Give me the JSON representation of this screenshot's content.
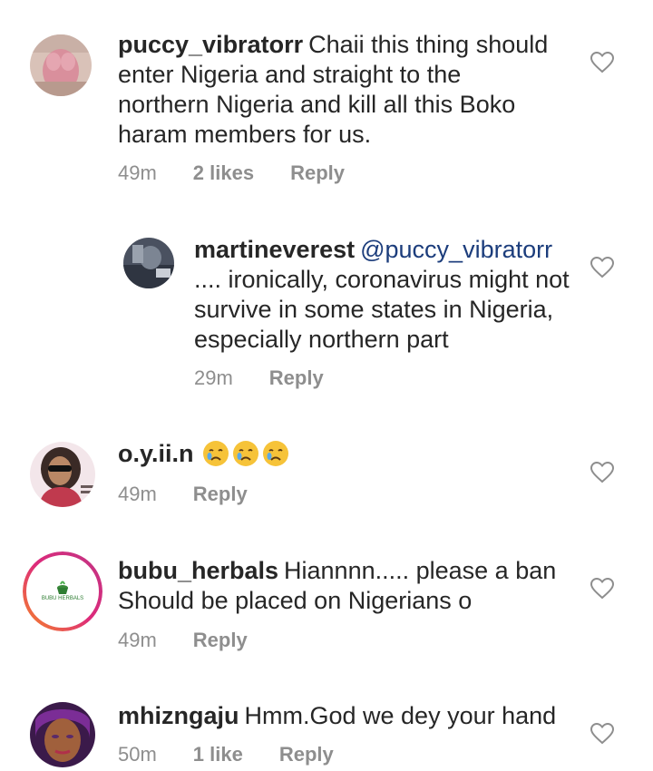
{
  "comments": [
    {
      "username": "puccy_vibratorr",
      "text": "Chaii this thing should enter Nigeria and straight to the northern Nigeria and kill all this Boko haram members for us.",
      "time": "49m",
      "likes": "2 likes",
      "reply": "Reply"
    },
    {
      "username": "martineverest",
      "mention": "@puccy_vibratorr",
      "text": ".... ironically, coronavirus might not survive in some states in Nigeria, especially northern part",
      "time": "29m",
      "reply": "Reply"
    },
    {
      "username": "o.y.ii.n",
      "text": "",
      "emojis": [
        "crying-face-emoji",
        "crying-face-emoji",
        "crying-face-emoji"
      ],
      "time": "49m",
      "reply": "Reply"
    },
    {
      "username": "bubu_herbals",
      "text": "Hiannnn..... please a ban Should be placed on Nigerians o",
      "time": "49m",
      "reply": "Reply",
      "avatar_text": "BUBU HERBALS"
    },
    {
      "username": "mhizngaju",
      "text": "Hmm.God we dey your hand",
      "time": "50m",
      "likes": "1 like",
      "reply": "Reply"
    }
  ],
  "colors": {
    "text": "#262626",
    "meta": "#8e8e8e",
    "mention": "#1c3d7c",
    "story_ring": "#e1306c"
  }
}
